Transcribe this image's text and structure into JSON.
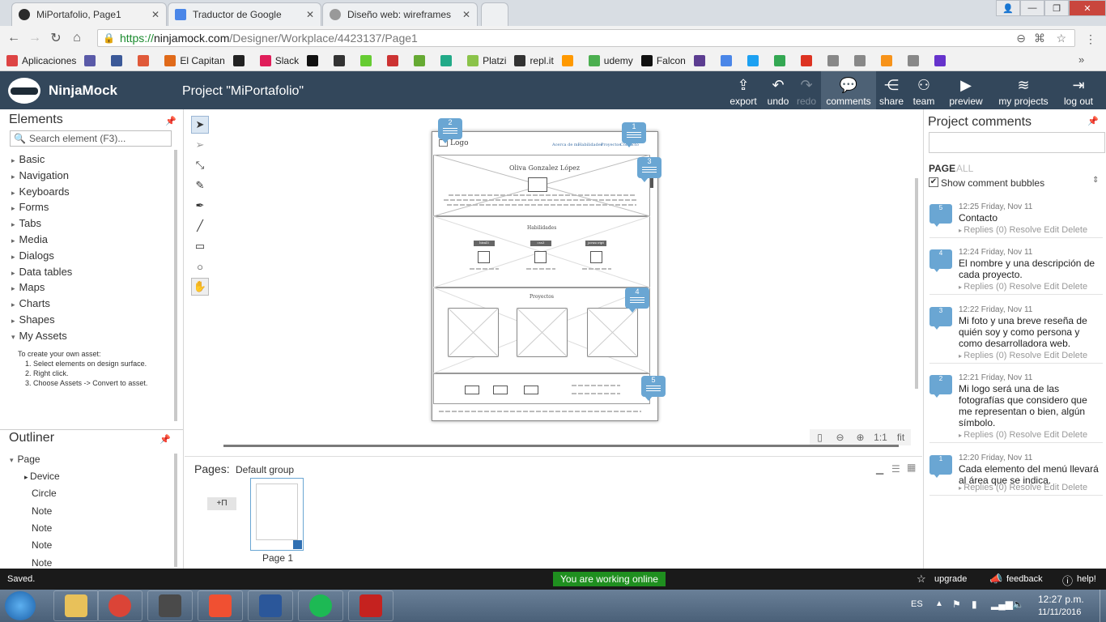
{
  "browser": {
    "tabs": [
      {
        "title": "MiPortafolio, Page1",
        "active": true,
        "color": "#2b2b2b"
      },
      {
        "title": "Traductor de Google",
        "active": false,
        "color": "#4a86e8"
      },
      {
        "title": "Diseño web: wireframes",
        "active": false,
        "color": "#888888"
      }
    ],
    "url": {
      "https": "https://",
      "host": "ninjamock.com",
      "path": "/Designer/Workplace/4423137/Page1"
    },
    "bookmarks": [
      {
        "label": "Aplicaciones",
        "icon": "apps-grid-icon",
        "color": "#d44"
      },
      {
        "label": "",
        "icon": "shield-icon",
        "color": "#5a5aa8"
      },
      {
        "label": "",
        "icon": "facebook-icon",
        "color": "#3b5998"
      },
      {
        "label": "",
        "icon": "trello-icon",
        "color": "#e05a3a"
      },
      {
        "label": "El Capitan",
        "icon": "code-icon",
        "color": "#e06a1a"
      },
      {
        "label": "",
        "icon": "codepen-icon",
        "color": "#222"
      },
      {
        "label": "Slack",
        "icon": "slack-icon",
        "color": "#e01e5a"
      },
      {
        "label": "",
        "icon": "github-icon",
        "color": "#111"
      },
      {
        "label": "",
        "icon": "alien-icon",
        "color": "#333"
      },
      {
        "label": "",
        "icon": "w3-icon",
        "color": "#6c3"
      },
      {
        "label": "",
        "icon": "book-icon",
        "color": "#c33"
      },
      {
        "label": "",
        "icon": "android-icon",
        "color": "#6a3"
      },
      {
        "label": "",
        "icon": "play-icon",
        "color": "#2a8"
      },
      {
        "label": "Platzi",
        "icon": "platzi-icon",
        "color": "#8bc34a"
      },
      {
        "label": "repl.it",
        "icon": "replit-icon",
        "color": "#333"
      },
      {
        "label": "",
        "icon": "orange-icon",
        "color": "#f90"
      },
      {
        "label": "udemy",
        "icon": "udemy-icon",
        "color": "#4caf50"
      },
      {
        "label": "Falcon",
        "icon": "fm-icon",
        "color": "#111"
      },
      {
        "label": "",
        "icon": "b-icon",
        "color": "#5c3d91"
      },
      {
        "label": "",
        "icon": "translate-icon",
        "color": "#4a86e8"
      },
      {
        "label": "",
        "icon": "twitter-icon",
        "color": "#1da1f2"
      },
      {
        "label": "",
        "icon": "maps-icon",
        "color": "#34a853"
      },
      {
        "label": "",
        "icon": "acrobat-icon",
        "color": "#d32"
      },
      {
        "label": "",
        "icon": "doc-icon",
        "color": "#888"
      },
      {
        "label": "",
        "icon": "doc-icon",
        "color": "#888"
      },
      {
        "label": "",
        "icon": "coin-icon",
        "color": "#f7931a"
      },
      {
        "label": "",
        "icon": "doc-icon",
        "color": "#888"
      },
      {
        "label": "",
        "icon": "list-icon",
        "color": "#6633cc"
      }
    ]
  },
  "app": {
    "brand": "NinjaMock",
    "project_title": "Project \"MiPortafolio\"",
    "toolbar": [
      {
        "label": "export",
        "icon": "export-icon",
        "glyph": "⇪",
        "state": "normal"
      },
      {
        "label": "undo",
        "icon": "undo-icon",
        "glyph": "↶",
        "state": "normal"
      },
      {
        "label": "redo",
        "icon": "redo-icon",
        "glyph": "↷",
        "state": "disabled"
      },
      {
        "label": "comments",
        "icon": "comments-icon",
        "glyph": "💬",
        "state": "selected"
      },
      {
        "label": "share",
        "icon": "share-icon",
        "glyph": "⋲",
        "state": "normal"
      },
      {
        "label": "team",
        "icon": "team-icon",
        "glyph": "⚇",
        "state": "normal"
      },
      {
        "label": "preview",
        "icon": "play-icon",
        "glyph": "▶",
        "state": "normal"
      },
      {
        "label": "my projects",
        "icon": "stack-icon",
        "glyph": "≋",
        "state": "normal"
      },
      {
        "label": "log out",
        "icon": "logout-icon",
        "glyph": "⇥",
        "state": "normal"
      }
    ],
    "accent": "#33475b"
  },
  "elements": {
    "heading": "Elements",
    "search_placeholder": "Search element (F3)...",
    "categories": [
      "Basic",
      "Navigation",
      "Keyboards",
      "Forms",
      "Tabs",
      "Media",
      "Dialogs",
      "Data tables",
      "Maps",
      "Charts",
      "Shapes",
      "My Assets"
    ],
    "assets_help": {
      "intro": "To create your own asset:",
      "steps": [
        "1. Select elements on design surface.",
        "2. Right click.",
        "3. Choose Assets -> Convert to asset."
      ]
    }
  },
  "outliner": {
    "heading": "Outliner",
    "root": "Page",
    "items": [
      "Device",
      "Circle",
      "Note",
      "Note",
      "Note",
      "Note"
    ]
  },
  "wireframe": {
    "logo": "Logo",
    "nav": [
      "Acerca de mí",
      "Habilidades",
      "Proyectos",
      "Contacto"
    ],
    "name": "Oliva Gonzalez López",
    "skills_title": "Habilidades",
    "skills": [
      "html5",
      "css3",
      "javascript"
    ],
    "projects_title": "Proyectos",
    "bubbles": [
      "1",
      "2",
      "3",
      "4",
      "5"
    ]
  },
  "zoom": {
    "one_to_one": "1:1",
    "fit": "fit"
  },
  "pages": {
    "label": "Pages:",
    "group": "Default group",
    "add_label": "+П",
    "thumb_label": "Page 1"
  },
  "comments": {
    "heading": "Project comments",
    "page_label": "PAGE",
    "all_label": "ALL",
    "show_bubbles": "Show comment bubbles",
    "actions": "Replies (0) Resolve Edit Delete",
    "items": [
      {
        "num": "5",
        "time": "12:25 Friday, Nov 11",
        "text": "Contacto"
      },
      {
        "num": "4",
        "time": "12:24 Friday, Nov 11",
        "text": "El nombre y una descripción de cada proyecto."
      },
      {
        "num": "3",
        "time": "12:22 Friday, Nov 11",
        "text": "Mi foto y una breve reseña de quién soy y como persona y como desarrolladora web."
      },
      {
        "num": "2",
        "time": "12:21 Friday, Nov 11",
        "text": "Mi logo será una de las fotografías que considero que me representan o bien, algún símbolo."
      },
      {
        "num": "1",
        "time": "12:20 Friday, Nov 11",
        "text": "Cada elemento del menú llevará al área que se indica."
      }
    ]
  },
  "status": {
    "saved": "Saved.",
    "online": "You are working online",
    "upgrade": "upgrade",
    "feedback": "feedback",
    "help": "help!"
  },
  "taskbar": {
    "lang": "ES",
    "time": "12:27 p.m.",
    "date": "11/11/2016",
    "apps": [
      {
        "icon": "start-icon",
        "color": "#2a7fd4"
      },
      {
        "icon": "explorer-icon",
        "color": "#e8c15a"
      },
      {
        "icon": "chrome-icon",
        "color": "#db4437"
      },
      {
        "icon": "sublime-icon",
        "color": "#4a4a4a"
      },
      {
        "icon": "git-icon",
        "color": "#f05032"
      },
      {
        "icon": "word-icon",
        "color": "#2b579a"
      },
      {
        "icon": "spotify-icon",
        "color": "#1db954"
      },
      {
        "icon": "acrobat-icon",
        "color": "#c5221f"
      }
    ]
  }
}
